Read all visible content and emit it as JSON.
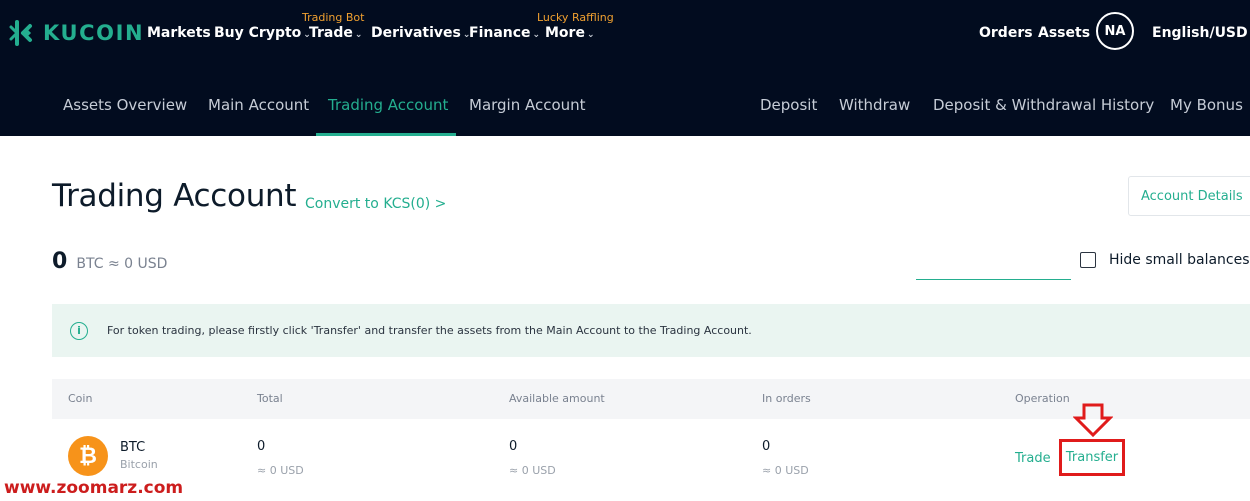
{
  "header": {
    "logo_text": "KUCOIN",
    "nav": [
      {
        "label": "Markets",
        "badge": "",
        "has_dropdown": false
      },
      {
        "label": "Buy Crypto",
        "badge": "",
        "has_dropdown": true
      },
      {
        "label": "Trade",
        "badge": "Trading Bot",
        "has_dropdown": true
      },
      {
        "label": "Derivatives",
        "badge": "",
        "has_dropdown": true
      },
      {
        "label": "Finance",
        "badge": "",
        "has_dropdown": true
      },
      {
        "label": "More",
        "badge": "Lucky Raffling",
        "has_dropdown": true
      }
    ],
    "orders_label": "Orders",
    "assets_label": "Assets",
    "avatar_initials": "NA",
    "language": "English/USD"
  },
  "subnav": {
    "left": [
      "Assets Overview",
      "Main Account",
      "Trading Account",
      "Margin Account"
    ],
    "right": [
      "Deposit",
      "Withdraw",
      "Deposit & Withdrawal History",
      "My Bonus"
    ],
    "active": "Trading Account"
  },
  "page": {
    "title": "Trading Account",
    "convert_link": "Convert to KCS(0) >",
    "account_details_button": "Account Details",
    "balance_value": "0",
    "balance_unit": "BTC ≈ 0 USD",
    "search_placeholder": "",
    "hide_small_label": "Hide small balances",
    "hide_small_checked": false,
    "notice": "For token trading, please firstly click 'Transfer' and transfer the assets from the Main Account to the Trading Account."
  },
  "table": {
    "columns": [
      "Coin",
      "Total",
      "Available amount",
      "In orders",
      "Operation"
    ],
    "rows": [
      {
        "symbol": "BTC",
        "name": "Bitcoin",
        "icon_glyph": "₿",
        "total": "0",
        "total_usd": "≈ 0 USD",
        "available": "0",
        "available_usd": "≈ 0 USD",
        "in_orders": "0",
        "in_orders_usd": "≈ 0 USD",
        "trade_label": "Trade",
        "transfer_label": "Transfer"
      }
    ]
  },
  "watermark": "www.zoomarz.com",
  "colors": {
    "brand": "#24ae8f",
    "nav_bg": "#020c1f",
    "badge": "#f0a030",
    "highlight": "#e01b1b",
    "btc": "#f7931a"
  }
}
